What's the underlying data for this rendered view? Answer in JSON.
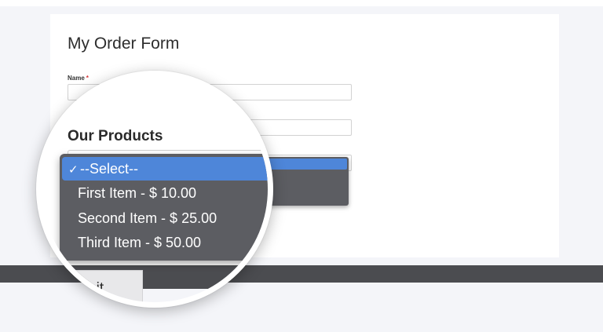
{
  "form": {
    "title": "My Order Form",
    "name_label": "Name",
    "required_mark": "*"
  },
  "products": {
    "heading": "Our Products",
    "options": [
      {
        "label": "--Select--",
        "selected": true
      },
      {
        "label": "First Item - $ 10.00",
        "selected": false
      },
      {
        "label": "Second Item - $ 25.00",
        "selected": false
      },
      {
        "label": "Third Item - $ 50.00",
        "selected": false
      }
    ],
    "check_glyph": "✓"
  },
  "submit": {
    "label": "Submit"
  },
  "colors": {
    "dropdown_bg": "#5c5d62",
    "highlight": "#4e86d9",
    "footer_band": "#4b4c50",
    "page_bg": "#f4f5f9"
  },
  "icons": {
    "check": "checkmark-icon"
  }
}
